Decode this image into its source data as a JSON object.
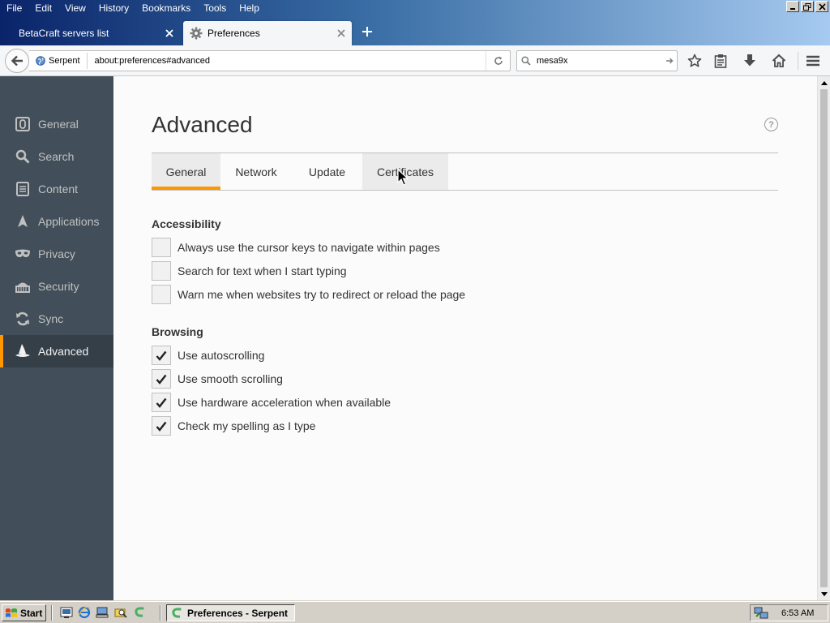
{
  "menubar": [
    "File",
    "Edit",
    "View",
    "History",
    "Bookmarks",
    "Tools",
    "Help"
  ],
  "tabs": [
    {
      "label": "BetaCraft servers list"
    },
    {
      "label": "Preferences"
    }
  ],
  "navbar": {
    "identity_label": "Serpent",
    "url": "about:preferences#advanced",
    "search_value": "mesa9x"
  },
  "sidebar": {
    "items": [
      {
        "label": "General",
        "icon": "general-icon"
      },
      {
        "label": "Search",
        "icon": "search-icon"
      },
      {
        "label": "Content",
        "icon": "content-icon"
      },
      {
        "label": "Applications",
        "icon": "applications-icon"
      },
      {
        "label": "Privacy",
        "icon": "privacy-icon"
      },
      {
        "label": "Security",
        "icon": "security-icon"
      },
      {
        "label": "Sync",
        "icon": "sync-icon"
      },
      {
        "label": "Advanced",
        "icon": "advanced-icon",
        "selected": true
      }
    ]
  },
  "page": {
    "title": "Advanced",
    "help": "?",
    "tabs": [
      "General",
      "Network",
      "Update",
      "Certificates"
    ],
    "selected_tab": "General"
  },
  "accessibility": {
    "title": "Accessibility",
    "items": [
      {
        "label": "Always use the cursor keys to navigate within pages",
        "checked": false
      },
      {
        "label": "Search for text when I start typing",
        "checked": false
      },
      {
        "label": "Warn me when websites try to redirect or reload the page",
        "checked": false
      }
    ]
  },
  "browsing": {
    "title": "Browsing",
    "items": [
      {
        "label": "Use autoscrolling",
        "checked": true
      },
      {
        "label": "Use smooth scrolling",
        "checked": true
      },
      {
        "label": "Use hardware acceleration when available",
        "checked": true
      },
      {
        "label": "Check my spelling as I type",
        "checked": true
      }
    ]
  },
  "taskbar": {
    "start_label": "Start",
    "task_label": "Preferences - Serpent",
    "clock": "6:53 AM"
  },
  "colors": {
    "accent": "#ff9500",
    "sidebar_bg": "#424f5a",
    "sidebar_selected_bg": "#343f48",
    "content_bg": "#fbfbfb"
  }
}
